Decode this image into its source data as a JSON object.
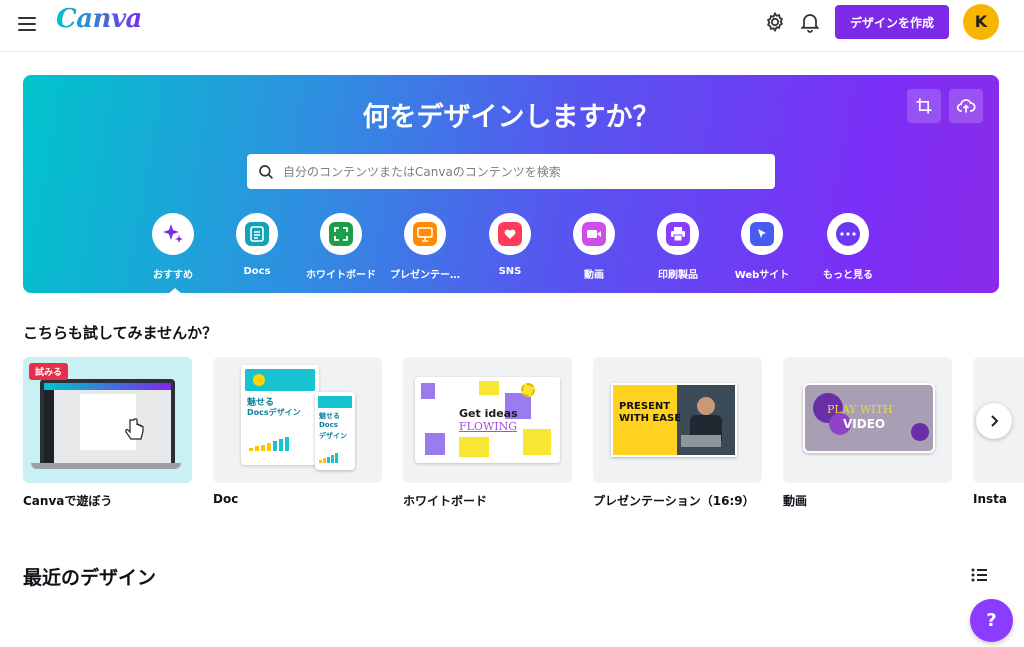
{
  "app": {
    "logo": "Canva"
  },
  "header": {
    "create_button": "デザインを作成",
    "avatar_initial": "K"
  },
  "hero": {
    "title": "何をデザインしますか？",
    "search_placeholder": "自分のコンテンツまたはCanvaのコンテンツを検索",
    "categories": [
      {
        "label": "おすすめ",
        "icon": "sparkle-icon",
        "color": "#7d2ae8"
      },
      {
        "label": "Docs",
        "icon": "docs-icon",
        "color": "#13a3b5"
      },
      {
        "label": "ホワイトボード",
        "icon": "whiteboard-icon",
        "color": "#1e9e4a"
      },
      {
        "label": "プレゼンテー…",
        "icon": "presentation-icon",
        "color": "#ff8a00"
      },
      {
        "label": "SNS",
        "icon": "heart-icon",
        "color": "#ff3b5c"
      },
      {
        "label": "動画",
        "icon": "video-icon",
        "color": "#d04ee8"
      },
      {
        "label": "印刷製品",
        "icon": "printer-icon",
        "color": "#8b3dff"
      },
      {
        "label": "Webサイト",
        "icon": "cursor-icon",
        "color": "#4a5cf0"
      },
      {
        "label": "もっと見る",
        "icon": "more-icon",
        "color": "#6b39f5"
      }
    ]
  },
  "suggestions": {
    "title": "こちらも試してみませんか？",
    "try_badge": "試みる",
    "items": [
      {
        "label": "Canvaで遊ぼう"
      },
      {
        "label": "Doc",
        "thumb_title": "魅せる",
        "thumb_sub": "Docsデザイン",
        "thumb_small_a": "魅せる",
        "thumb_small_b": "Docs",
        "thumb_small_c": "デザイン"
      },
      {
        "label": "ホワイトボード",
        "thumb_line1": "Get ideas",
        "thumb_line2": "FLOWING"
      },
      {
        "label": "プレゼンテーション（16:9）",
        "thumb_line1": "PRESENT",
        "thumb_line2": "WITH EASE"
      },
      {
        "label": "動画",
        "thumb_line1": "PLAY WITH",
        "thumb_line2": "VIDEO"
      },
      {
        "label": "Insta"
      }
    ]
  },
  "recent": {
    "title": "最近のデザイン"
  },
  "help": {
    "label": "?"
  },
  "colors": {
    "accent": "#7d2ae8",
    "avatar": "#f7b500",
    "badge": "#e5304b"
  }
}
